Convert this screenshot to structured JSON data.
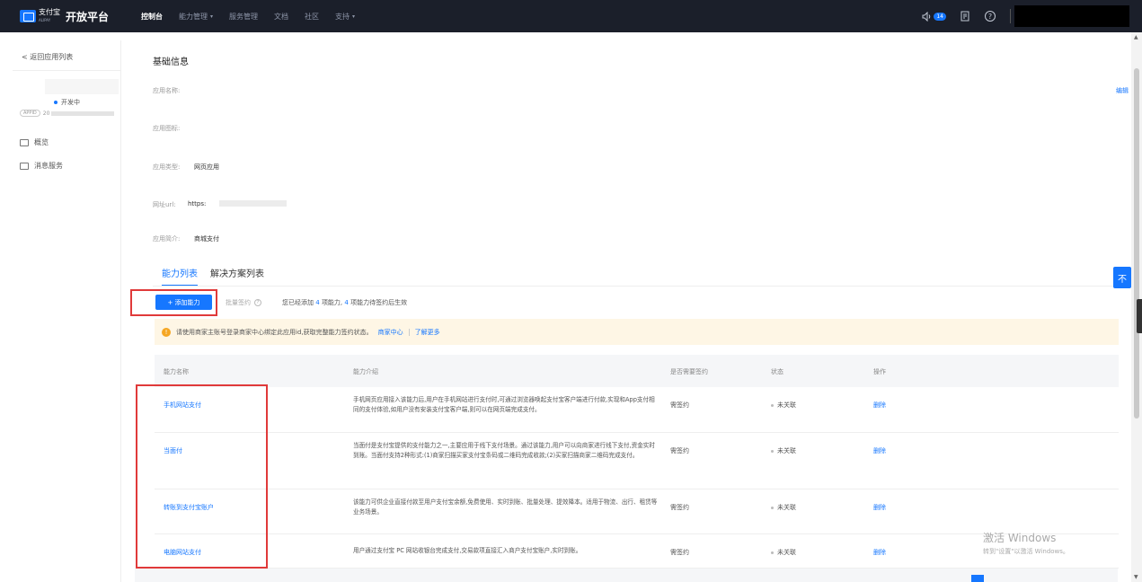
{
  "topbar": {
    "logo_cn": "支付宝",
    "logo_en": "ALIPAY",
    "platform_title": "开放平台",
    "nav": [
      {
        "label": "控制台",
        "active": true,
        "caret": false
      },
      {
        "label": "能力管理",
        "active": false,
        "caret": true
      },
      {
        "label": "服务管理",
        "active": false,
        "caret": false
      },
      {
        "label": "文档",
        "active": false,
        "caret": false
      },
      {
        "label": "社区",
        "active": false,
        "caret": false
      },
      {
        "label": "支持",
        "active": false,
        "caret": true
      }
    ],
    "notification_count": "14",
    "help_glyph": "?"
  },
  "sidebar": {
    "back_label": "< 返回应用列表",
    "app_status": "开发中",
    "appid_tag": "APPID",
    "appid_prefix": "20",
    "items": [
      {
        "label": "概览"
      },
      {
        "label": "消息服务"
      }
    ]
  },
  "basic_info": {
    "title": "基础信息",
    "edit": "编辑",
    "name_label": "应用名称:",
    "icon_label": "应用图标:",
    "type_label": "应用类型:",
    "type_value": "网页应用",
    "url_label": "网址url:",
    "url_value": "https:",
    "intro_label": "应用简介:",
    "intro_value": "商城支付"
  },
  "tabs": [
    {
      "label": "能力列表",
      "active": true
    },
    {
      "label": "解决方案列表",
      "active": false
    }
  ],
  "toolbar": {
    "add_label": "+ 添加能力",
    "batch_label": "批量签约",
    "count_prefix": "您已经添加",
    "count_added": "4",
    "count_mid": "项能力,",
    "count_pending": "4",
    "count_suffix": "项能力待签约后生效"
  },
  "alert": {
    "text": "请使用商家主账号登录商家中心绑定此应用id,获取完整能力签约状态。",
    "link1": "商家中心",
    "link2": "了解更多"
  },
  "table": {
    "headers": {
      "name": "能力名称",
      "desc": "能力介绍",
      "sign": "是否需要签约",
      "status": "状态",
      "op": "操作"
    },
    "rows": [
      {
        "name": "手机网站支付",
        "desc": "手机网页应用接入该能力后,用户在手机网站进行支付时,可通过浏览器唤起支付宝客户端进行付款,实现和App支付相同的支付体验,如用户没有安装支付宝客户端,则可以在网页端完成支付。",
        "sign": "需签约",
        "status": "未关联",
        "op": "删除"
      },
      {
        "name": "当面付",
        "desc": "当面付是支付宝提供的支付能力之一,主要应用于线下支付场景。通过该能力,用户可以向商家进行线下支付,资金实时到账。当面付支持2种形式:(1)商家扫描买家支付宝条码或二维码完成收款;(2)买家扫描商家二维码完成支付。",
        "sign": "需签约",
        "status": "未关联",
        "op": "删除"
      },
      {
        "name": "转账到支付宝账户",
        "desc": "该能力可供企业直接付款至用户支付宝余额,免费使用、实时到账、批量处理、提效降本。适用于物流、出行、租赁等业务场景。",
        "sign": "需签约",
        "status": "未关联",
        "op": "删除"
      },
      {
        "name": "电脑网站支付",
        "desc": "用户通过支付宝 PC 网站收银台完成支付,交易款项直接汇入商户支付宝账户,实时到账。",
        "sign": "需签约",
        "status": "未关联",
        "op": "删除"
      }
    ]
  },
  "float_button": "不",
  "watermark": {
    "line1": "激活 Windows",
    "line2": "转到\"设置\"以激活 Windows。"
  },
  "colors": {
    "primary": "#1677ff",
    "topbar": "#1b1f2a",
    "highlight": "#e03a3a",
    "alert_bg": "#fef6e5"
  }
}
